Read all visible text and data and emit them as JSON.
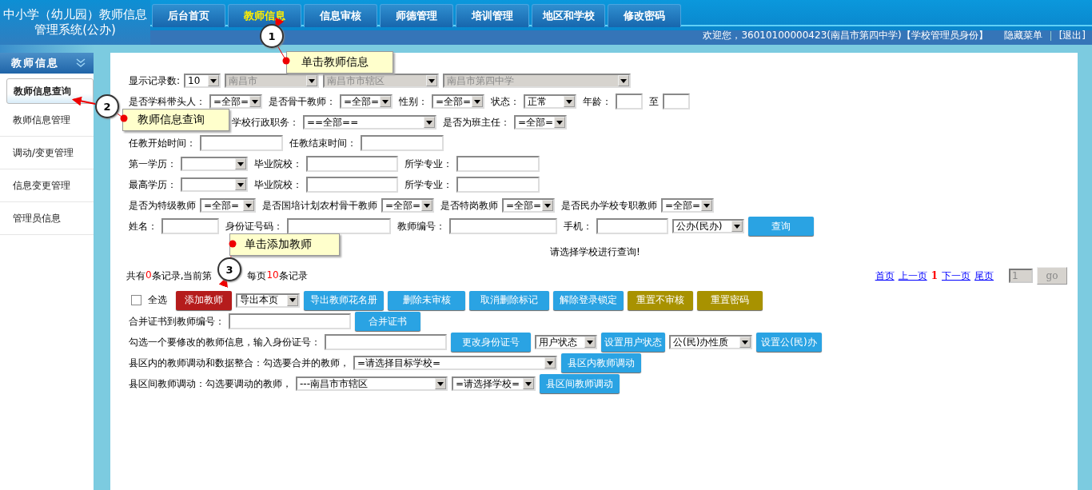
{
  "header": {
    "title_lines": [
      "中小学（幼儿园）教师信息",
      "管理系统(公办)"
    ],
    "tabs": [
      {
        "label": "后台首页",
        "selected": false
      },
      {
        "label": "教师信息",
        "selected": true
      },
      {
        "label": "信息审核",
        "selected": false
      },
      {
        "label": "师德管理",
        "selected": false
      },
      {
        "label": "培训管理",
        "selected": false
      },
      {
        "label": "地区和学校",
        "selected": false
      },
      {
        "label": "修改密码",
        "selected": false
      }
    ],
    "welcome": "欢迎您，36010100000423(南昌市第四中学)【学校管理员身份】",
    "hide_menu": "隐藏菜单",
    "logout": "[退出]"
  },
  "sidebar": {
    "title": "教师信息",
    "items": [
      {
        "label": "教师信息查询",
        "selected": true
      },
      {
        "label": "教师信息管理",
        "selected": false
      },
      {
        "label": "调动/变更管理",
        "selected": false
      },
      {
        "label": "信息变更管理",
        "selected": false
      },
      {
        "label": "管理员信息",
        "selected": false
      }
    ]
  },
  "search_form": {
    "rows": [
      {
        "items": [
          {
            "kind": "label",
            "text": "显示记录数:"
          },
          {
            "kind": "select",
            "value": "10",
            "disabled": false
          },
          {
            "kind": "select",
            "value": "南昌市",
            "disabled": true
          },
          {
            "kind": "select",
            "value": "南昌市市辖区",
            "disabled": true
          },
          {
            "kind": "select",
            "value": "南昌市第四中学",
            "disabled": true
          }
        ]
      },
      {
        "items": [
          {
            "kind": "label",
            "text": "是否学科带头人："
          },
          {
            "kind": "select",
            "value": "=全部=",
            "disabled": false
          },
          {
            "kind": "label",
            "text": "是否骨干教师："
          },
          {
            "kind": "select",
            "value": "=全部=",
            "disabled": false
          },
          {
            "kind": "label",
            "text": "性别："
          },
          {
            "kind": "select",
            "value": "=全部=",
            "disabled": false
          },
          {
            "kind": "label",
            "text": "状态："
          },
          {
            "kind": "select",
            "value": "正常",
            "disabled": false
          },
          {
            "kind": "label",
            "text": "年龄："
          },
          {
            "kind": "input"
          },
          {
            "kind": "label",
            "text": "至"
          },
          {
            "kind": "input"
          }
        ]
      },
      {
        "items": [
          {
            "kind": "label",
            "text": "学校行政职务："
          },
          {
            "kind": "select",
            "value": "==全部==",
            "disabled": false
          },
          {
            "kind": "label",
            "text": "是否为班主任："
          },
          {
            "kind": "select",
            "value": "=全部=",
            "disabled": false
          }
        ]
      },
      {
        "items": [
          {
            "kind": "label",
            "text": "任教开始时间："
          },
          {
            "kind": "input"
          },
          {
            "kind": "label",
            "text": "任教结束时间："
          },
          {
            "kind": "input"
          }
        ]
      },
      {
        "items": [
          {
            "kind": "label",
            "text": "第一学历："
          },
          {
            "kind": "select",
            "disabled": false
          },
          {
            "kind": "label",
            "text": "毕业院校："
          },
          {
            "kind": "input"
          },
          {
            "kind": "label",
            "text": "所学专业："
          },
          {
            "kind": "input"
          }
        ]
      },
      {
        "items": [
          {
            "kind": "label",
            "text": "最高学历："
          },
          {
            "kind": "select",
            "disabled": false
          },
          {
            "kind": "label",
            "text": "毕业院校："
          },
          {
            "kind": "input"
          },
          {
            "kind": "label",
            "text": "所学专业："
          },
          {
            "kind": "input"
          }
        ]
      },
      {
        "items": [
          {
            "kind": "label",
            "text": "是否为特级教师"
          },
          {
            "kind": "select",
            "value": "=全部=",
            "disabled": false
          },
          {
            "kind": "label",
            "text": "是否国培计划农村骨干教师"
          },
          {
            "kind": "select",
            "value": "=全部=",
            "disabled": false
          },
          {
            "kind": "label",
            "text": "是否特岗教师"
          },
          {
            "kind": "select",
            "value": "=全部=",
            "disabled": false
          },
          {
            "kind": "label",
            "text": "是否民办学校专职教师"
          },
          {
            "kind": "select",
            "value": "=全部=",
            "disabled": false
          }
        ]
      },
      {
        "items": [
          {
            "kind": "label",
            "text": "姓名："
          },
          {
            "kind": "input"
          },
          {
            "kind": "label",
            "text": "身份证号码："
          },
          {
            "kind": "input"
          },
          {
            "kind": "label",
            "text": "教师编号："
          },
          {
            "kind": "input"
          },
          {
            "kind": "label",
            "text": "手机："
          },
          {
            "kind": "input"
          },
          {
            "kind": "select",
            "value": "公办(民办)",
            "disabled": false
          },
          {
            "kind": "button",
            "text": "查询",
            "color": "#2aa3e3"
          }
        ]
      }
    ]
  },
  "message": "请选择学校进行查询!",
  "record_info": [
    {
      "text": "共有",
      "highlight": false
    },
    {
      "text": "0",
      "highlight": true
    },
    {
      "text": "条记录,当前第",
      "highlight": false
    },
    {
      "text": "每页",
      "highlight": false
    },
    {
      "text": "10",
      "highlight": true
    },
    {
      "text": "条记录",
      "highlight": false
    }
  ],
  "pagination": {
    "links": [
      "首页",
      "上一页"
    ],
    "current": "1",
    "links_after": [
      "下一页",
      "尾页"
    ],
    "page_input": "1",
    "go": "go"
  },
  "actions": {
    "rows": [
      {
        "items": [
          {
            "kind": "checkbox",
            "text": "全选",
            "checked": false
          },
          {
            "kind": "button",
            "text": "添加教师",
            "color": "#b51c1c"
          },
          {
            "kind": "select",
            "value": "导出本页",
            "disabled": false
          },
          {
            "kind": "button",
            "text": "导出教师花名册",
            "color": "#2aa3e3"
          },
          {
            "kind": "button",
            "text": "删除未审核",
            "color": "#2aa3e3"
          },
          {
            "kind": "button",
            "text": "取消删除标记",
            "color": "#2aa3e3"
          },
          {
            "kind": "button",
            "text": "解除登录锁定",
            "color": "#2aa3e3"
          },
          {
            "kind": "button",
            "text": "重置不审核",
            "color": "#a89200"
          },
          {
            "kind": "button",
            "text": "重置密码",
            "color": "#a89200"
          }
        ]
      },
      {
        "items": [
          {
            "kind": "label",
            "text": "合并证书到教师编号："
          },
          {
            "kind": "input"
          },
          {
            "kind": "button",
            "text": "合并证书",
            "color": "#2aa3e3"
          }
        ]
      },
      {
        "items": [
          {
            "kind": "label",
            "text": "勾选一个要修改的教师信息，输入身份证号："
          },
          {
            "kind": "input"
          },
          {
            "kind": "button",
            "text": "更改身份证号",
            "color": "#2aa3e3"
          },
          {
            "kind": "select",
            "value": "用户状态",
            "disabled": false
          },
          {
            "kind": "button",
            "text": "设置用户状态",
            "color": "#2aa3e3"
          },
          {
            "kind": "select",
            "value": "公(民)办性质",
            "disabled": false
          },
          {
            "kind": "button",
            "text": "设置公(民)办",
            "color": "#2aa3e3"
          }
        ]
      },
      {
        "items": [
          {
            "kind": "label",
            "text": "县区内的教师调动和数据整合：勾选要合并的教师，"
          },
          {
            "kind": "select",
            "value": "=请选择目标学校=",
            "disabled": false
          },
          {
            "kind": "button",
            "text": "县区内教师调动",
            "color": "#2aa3e3"
          }
        ]
      },
      {
        "items": [
          {
            "kind": "label",
            "text": "县区间教师调动：勾选要调动的教师，"
          },
          {
            "kind": "select",
            "value": "---南昌市市辖区",
            "disabled": false
          },
          {
            "kind": "select",
            "value": "=请选择学校=",
            "disabled": false
          },
          {
            "kind": "button",
            "text": "县区间教师调动",
            "color": "#2aa3e3"
          }
        ]
      }
    ]
  },
  "callouts": [
    {
      "number": "1",
      "text": "单击教师信息"
    },
    {
      "number": "2",
      "text": "教师信息查询"
    },
    {
      "number": "3",
      "text": "单击添加教师"
    }
  ]
}
